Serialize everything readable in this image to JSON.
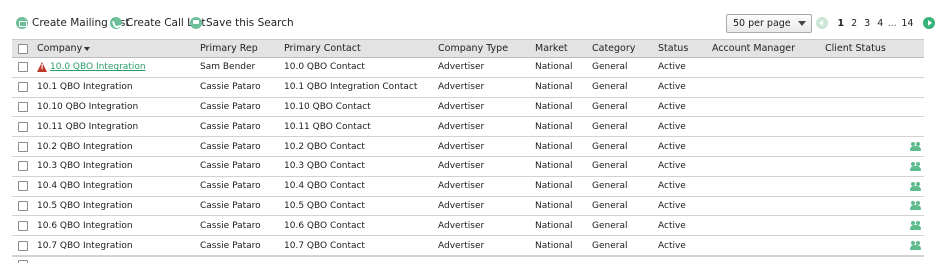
{
  "toolbar": {
    "create_mailing_list": "Create Mailing List",
    "create_call_list": "Create Call List",
    "save_search": "Save this Search",
    "per_page": "50 per page"
  },
  "pager": {
    "pages": [
      "1",
      "2",
      "3",
      "4"
    ],
    "ellipsis": "...",
    "last": "14",
    "current": "1"
  },
  "columns": {
    "company": "Company",
    "primary_rep": "Primary Rep",
    "primary_contact": "Primary Contact",
    "company_type": "Company Type",
    "market": "Market",
    "category": "Category",
    "status": "Status",
    "account_manager": "Account Manager",
    "client_status": "Client Status"
  },
  "rows": [
    {
      "company": "10.0 QBO Integration",
      "rep": "Sam Bender",
      "contact": "10.0 QBO Contact",
      "type": "Advertiser",
      "market": "National",
      "category": "General",
      "status": "Active",
      "warning": true,
      "link": true,
      "client_icon": false
    },
    {
      "company": "10.1 QBO Integration",
      "rep": "Cassie Pataro",
      "contact": "10.1 QBO Integration Contact",
      "type": "Advertiser",
      "market": "National",
      "category": "General",
      "status": "Active",
      "warning": false,
      "link": false,
      "client_icon": false
    },
    {
      "company": "10.10 QBO Integration",
      "rep": "Cassie Pataro",
      "contact": "10.10 QBO Contact",
      "type": "Advertiser",
      "market": "National",
      "category": "General",
      "status": "Active",
      "warning": false,
      "link": false,
      "client_icon": false
    },
    {
      "company": "10.11 QBO Integration",
      "rep": "Cassie Pataro",
      "contact": "10.11 QBO Contact",
      "type": "Advertiser",
      "market": "National",
      "category": "General",
      "status": "Active",
      "warning": false,
      "link": false,
      "client_icon": false
    },
    {
      "company": "10.2 QBO Integration",
      "rep": "Cassie Pataro",
      "contact": "10.2 QBO Contact",
      "type": "Advertiser",
      "market": "National",
      "category": "General",
      "status": "Active",
      "warning": false,
      "link": false,
      "client_icon": true
    },
    {
      "company": "10.3 QBO Integration",
      "rep": "Cassie Pataro",
      "contact": "10.3 QBO Contact",
      "type": "Advertiser",
      "market": "National",
      "category": "General",
      "status": "Active",
      "warning": false,
      "link": false,
      "client_icon": true
    },
    {
      "company": "10.4 QBO Integration",
      "rep": "Cassie Pataro",
      "contact": "10.4 QBO Contact",
      "type": "Advertiser",
      "market": "National",
      "category": "General",
      "status": "Active",
      "warning": false,
      "link": false,
      "client_icon": true
    },
    {
      "company": "10.5 QBO Integration",
      "rep": "Cassie Pataro",
      "contact": "10.5 QBO Contact",
      "type": "Advertiser",
      "market": "National",
      "category": "General",
      "status": "Active",
      "warning": false,
      "link": false,
      "client_icon": true
    },
    {
      "company": "10.6 QBO Integration",
      "rep": "Cassie Pataro",
      "contact": "10.6 QBO Contact",
      "type": "Advertiser",
      "market": "National",
      "category": "General",
      "status": "Active",
      "warning": false,
      "link": false,
      "client_icon": true
    },
    {
      "company": "10.7 QBO Integration",
      "rep": "Cassie Pataro",
      "contact": "10.7 QBO Contact",
      "type": "Advertiser",
      "market": "National",
      "category": "General",
      "status": "Active",
      "warning": false,
      "link": false,
      "client_icon": true
    }
  ],
  "colors": {
    "accent": "#38b27a",
    "link": "#2a9d6a",
    "header_bg": "#e3e3e3",
    "warning": "#c0392b"
  },
  "icons": {
    "mailing_list": "envelope-icon",
    "call_list": "phone-icon",
    "save_search": "save-icon",
    "warning": "warning-triangle-icon",
    "client_status": "group-icon"
  }
}
